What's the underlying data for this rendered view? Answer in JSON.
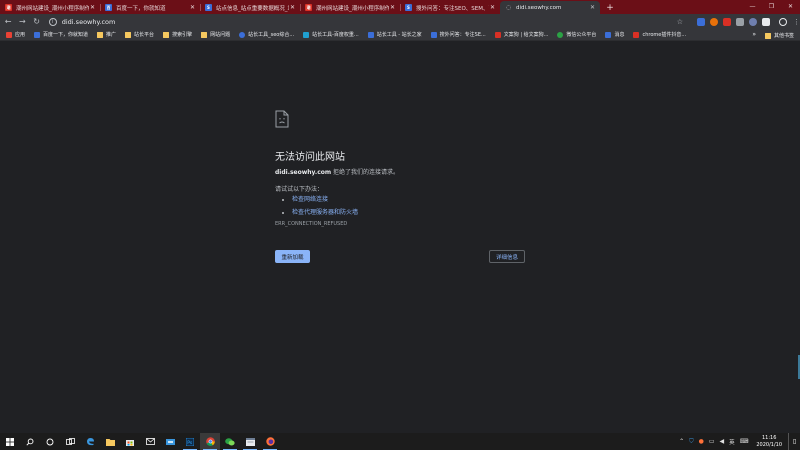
{
  "tabs": [
    {
      "title": "潮州网站建设_潮州小程序制作_潮州网络公司",
      "fav_color": "#d93025",
      "fav_glyph": "潮"
    },
    {
      "title": "百度一下，你就知道",
      "fav_color": "#3b6ed8",
      "fav_glyph": "百"
    },
    {
      "title": "站点信息_站点重要数据概况_站长工具",
      "fav_color": "#3b6ed8",
      "fav_glyph": "S"
    },
    {
      "title": "潮州网站建设_潮州小程序制作_潮州网络公司",
      "fav_color": "#d93025",
      "fav_glyph": "潮"
    },
    {
      "title": "搜外问答：专注SEO、SEM、营销",
      "fav_color": "#3b6ed8",
      "fav_glyph": "S"
    },
    {
      "title": "didi.seowhy.com",
      "fav_color": "#5f6368",
      "fav_glyph": "◌"
    }
  ],
  "omnibox": {
    "url": "didi.seowhy.com"
  },
  "bookmarks": {
    "items": [
      {
        "label": "应用",
        "icon_color": "#e94235"
      },
      {
        "label": "百度一下，你就知道",
        "icon_color": "#3b6ed8"
      },
      {
        "label": "推广",
        "icon_color": "folder"
      },
      {
        "label": "站长平台",
        "icon_color": "folder"
      },
      {
        "label": "搜索引擎",
        "icon_color": "folder"
      },
      {
        "label": "网站问题",
        "icon_color": "folder"
      },
      {
        "label": "站长工具_seo综合...",
        "icon_color": "#3b6ed8"
      },
      {
        "label": "站长工具-百度权重...",
        "icon_color": "#20a0d0"
      },
      {
        "label": "站长工具 - 站长之家",
        "icon_color": "#3b6ed8"
      },
      {
        "label": "搜外问答：专注SE...",
        "icon_color": "#3b6ed8"
      },
      {
        "label": "文案狗 | 给文案狗...",
        "icon_color": "#d93025"
      },
      {
        "label": "微信公众平台",
        "icon_color": "#2ba245"
      },
      {
        "label": "消息",
        "icon_color": "#3b6ed8"
      },
      {
        "label": "chrome插件抖音...",
        "icon_color": "#d93025"
      }
    ],
    "more": "»",
    "other": "其他书签"
  },
  "error": {
    "title": "无法访问此网站",
    "host": "didi.seowhy.com",
    "desc_suffix": " 拒绝了我们的连接请求。",
    "try_label": "请试试以下办法：",
    "suggestions": [
      "检查网络连接",
      "检查代理服务器和防火墙"
    ],
    "code": "ERR_CONNECTION_REFUSED",
    "reload_label": "重新加载",
    "details_label": "详细信息"
  },
  "taskbar": {
    "time": "11:16",
    "date": "2020/1/10",
    "ime": "英"
  }
}
